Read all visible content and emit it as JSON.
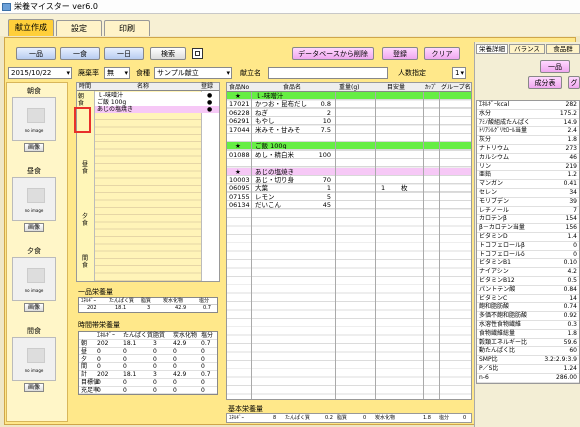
{
  "window": {
    "title": "栄養マイスター ver6.0"
  },
  "tabs": [
    {
      "label": "献立作成"
    },
    {
      "label": "設定"
    },
    {
      "label": "印刷"
    }
  ],
  "toolbar": {
    "btn_ichihin": "一品",
    "btn_isshoku": "一食",
    "btn_ichinichi": "一日",
    "btn_search": "検索",
    "btn_delete_db": "データベースから削除",
    "btn_register": "登録",
    "btn_clear": "クリア"
  },
  "filter": {
    "date": "2015/10/22",
    "waste_label": "廃棄率",
    "waste_value": "無",
    "type_label": "食種",
    "type_value": "サンプル献立",
    "menu_name_label": "献立名",
    "menu_name_value": "",
    "people_label": "人数指定",
    "people_value": "1"
  },
  "meals": [
    {
      "title": "朝食",
      "image_text": "no image",
      "button": "画像"
    },
    {
      "title": "昼食",
      "image_text": "no image",
      "button": "画像"
    },
    {
      "title": "夕食",
      "image_text": "no image",
      "button": "画像"
    },
    {
      "title": "間食",
      "image_text": "no image",
      "button": "画像"
    }
  ],
  "menu_list": {
    "headers": {
      "time": "時間",
      "name": "名称",
      "register": "登録"
    },
    "side_labels": {
      "breakfast": "朝食",
      "lunch": "昼食",
      "dinner": "夕食",
      "snack": "間食"
    },
    "rows": [
      {
        "name": "ｌ-味噌汁",
        "mark": "●"
      },
      {
        "name": "ご飯 100g",
        "mark": "●"
      },
      {
        "name": "あじの塩焼き",
        "mark": "●"
      }
    ]
  },
  "single_nutrition": {
    "title": "一品栄養量",
    "headers": [
      "ｴﾈﾙｷﾞｰ",
      "たんぱく質",
      "脂質",
      "炭水化物",
      "塩分"
    ],
    "values": [
      "202",
      "18.1",
      "3",
      "42.9",
      "0.7"
    ]
  },
  "period_nutrition": {
    "title": "時間帯栄養量",
    "headers": [
      "",
      "ｴﾈﾙｷﾞｰ",
      "たんぱく質",
      "脂質",
      "炭水化物",
      "塩分"
    ],
    "rows": [
      {
        "label": "朝",
        "values": [
          "202",
          "18.1",
          "3",
          "42.9",
          "0.7"
        ]
      },
      {
        "label": "昼",
        "values": [
          "0",
          "0",
          "0",
          "0",
          "0"
        ]
      },
      {
        "label": "夕",
        "values": [
          "0",
          "0",
          "0",
          "0",
          "0"
        ]
      },
      {
        "label": "間",
        "values": [
          "0",
          "0",
          "0",
          "0",
          "0"
        ]
      },
      {
        "label": "計",
        "values": [
          "202",
          "18.1",
          "3",
          "42.9",
          "0.7"
        ]
      },
      {
        "label": "目標値",
        "values": [
          "0",
          "0",
          "0",
          "0",
          "0"
        ]
      },
      {
        "label": "充足率",
        "values": [
          "0",
          "0",
          "0",
          "0",
          "0"
        ]
      }
    ]
  },
  "food_table": {
    "headers": {
      "no": "食品No",
      "name": "食品名",
      "weight": "重量(g)",
      "guide": "目安量",
      "cup": "ｶｯﾌﾟ",
      "group": "グループ名"
    },
    "rows": [
      {
        "type": "dish",
        "star": "★",
        "no": "",
        "name": "ｌ-味噌汁",
        "weight": "",
        "guide": "",
        "unit": ""
      },
      {
        "type": "food",
        "no": "17021",
        "name": "かつお・昆布だし",
        "weight": "0.8",
        "guide": "",
        "unit": ""
      },
      {
        "type": "food",
        "no": "06228",
        "name": "ねぎ",
        "weight": "2",
        "guide": "",
        "unit": ""
      },
      {
        "type": "food",
        "no": "06291",
        "name": "もやし",
        "weight": "10",
        "guide": "",
        "unit": ""
      },
      {
        "type": "food",
        "no": "17044",
        "name": "米みそ・甘みそ",
        "weight": "7.5",
        "guide": "",
        "unit": ""
      },
      {
        "type": "empty",
        "no": "",
        "name": "",
        "weight": "",
        "guide": "",
        "unit": ""
      },
      {
        "type": "dish",
        "star": "★",
        "no": "",
        "name": "ご飯 100g",
        "weight": "",
        "guide": "",
        "unit": ""
      },
      {
        "type": "food",
        "no": "01088",
        "name": "めし・精白米",
        "weight": "100",
        "guide": "",
        "unit": ""
      },
      {
        "type": "empty",
        "no": "",
        "name": "",
        "weight": "",
        "guide": "",
        "unit": ""
      },
      {
        "type": "dish2",
        "star": "★",
        "no": "",
        "name": "あじの塩焼き",
        "weight": "",
        "guide": "",
        "unit": ""
      },
      {
        "type": "food",
        "no": "10003",
        "name": "あじ・切り身",
        "weight": "70",
        "guide": "",
        "unit": ""
      },
      {
        "type": "food",
        "no": "06095",
        "name": "大葉",
        "weight": "1",
        "guide": "1",
        "unit": "枚"
      },
      {
        "type": "food",
        "no": "07155",
        "name": "レモン",
        "weight": "5",
        "guide": "",
        "unit": ""
      },
      {
        "type": "food",
        "no": "06134",
        "name": "だいこん",
        "weight": "45",
        "guide": "",
        "unit": ""
      }
    ]
  },
  "base_nutrition": {
    "title": "基本栄養量",
    "items": [
      {
        "label": "ｴﾈﾙｷﾞｰ",
        "value": "8"
      },
      {
        "label": "たんぱく質",
        "value": "0.2"
      },
      {
        "label": "脂質",
        "value": "0"
      },
      {
        "label": "炭水化物",
        "value": "1.8"
      },
      {
        "label": "塩分",
        "value": "0"
      }
    ]
  },
  "right_panel": {
    "tabs": [
      "栄養詳細",
      "バランス",
      "食品群"
    ],
    "buttons": {
      "ichihin": "一品",
      "seibunhyo": "成分表",
      "grafu": "グ"
    },
    "nutrients": [
      {
        "name": "ｴﾈﾙｷﾞｰkcal",
        "value": "282"
      },
      {
        "name": "水分",
        "value": "175.2"
      },
      {
        "name": "ｱﾐﾉ酸組成たんぱく",
        "value": "14.9"
      },
      {
        "name": "ﾄﾘｱｼﾙｸﾞﾘｾﾛｰﾙ当量",
        "value": "2.4"
      },
      {
        "name": "灰分",
        "value": "1.8"
      },
      {
        "name": "ナトリウム",
        "value": "273"
      },
      {
        "name": "カルシウム",
        "value": "46"
      },
      {
        "name": "リン",
        "value": "219"
      },
      {
        "name": "亜鉛",
        "value": "1.2"
      },
      {
        "name": "マンガン",
        "value": "0.41"
      },
      {
        "name": "セレン",
        "value": "34"
      },
      {
        "name": "モリブデン",
        "value": "39"
      },
      {
        "name": "レチノール",
        "value": "7"
      },
      {
        "name": "カロテンβ",
        "value": "154"
      },
      {
        "name": "β－カロテン当量",
        "value": "156"
      },
      {
        "name": "ビタミンD",
        "value": "1.4"
      },
      {
        "name": "トコフェロールβ",
        "value": "0"
      },
      {
        "name": "トコフェロールδ",
        "value": "0"
      },
      {
        "name": "ビタミンB1",
        "value": "0.10"
      },
      {
        "name": "ナイアシン",
        "value": "4.2"
      },
      {
        "name": "ビタミンB12",
        "value": "0.5"
      },
      {
        "name": "パントテン酸",
        "value": "0.84"
      },
      {
        "name": "ビタミンC",
        "value": "14"
      },
      {
        "name": "飽和脂肪酸",
        "value": "0.74"
      },
      {
        "name": "多価不飽和脂肪酸",
        "value": "0.92"
      },
      {
        "name": "水溶性食物繊維",
        "value": "0.3"
      },
      {
        "name": "食物繊維総量",
        "value": "1.8"
      },
      {
        "name": "穀類エネルギー比",
        "value": "59.6"
      },
      {
        "name": "動たんぱく比",
        "value": "60"
      },
      {
        "name": "SMP比",
        "value": "3.2:2.9:3.9"
      },
      {
        "name": "P／S比",
        "value": "1.24"
      },
      {
        "name": "n-6",
        "value": "286.00"
      }
    ]
  }
}
